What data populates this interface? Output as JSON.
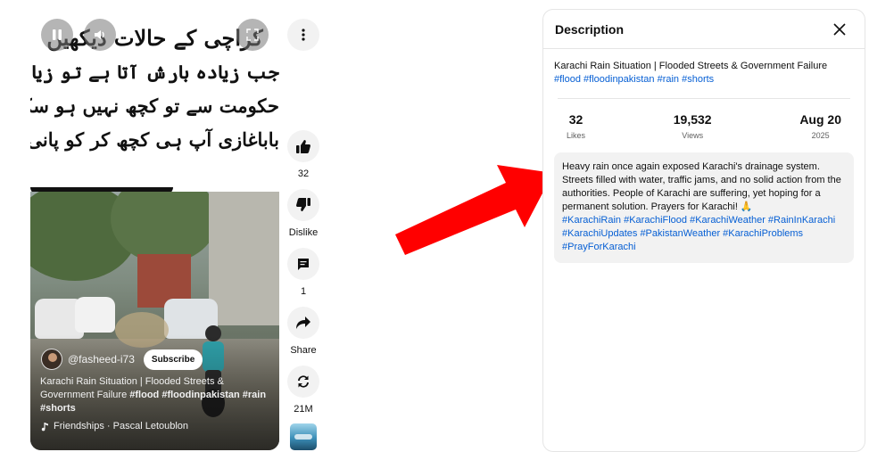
{
  "short": {
    "overlay_lines": [
      "کراچی کے حالات دیکھیں",
      "جب زیادہ بارش آتا ہے تو زیادہ پانی آتا ہے",
      "حکومت سے تو کچھ نہیں ہو سکا کراچی کے لیے",
      "باباغازی آپ ہی کچھ کر کو پانی کو روکو"
    ],
    "channel_name": "@fasheed-i73",
    "subscribe_label": "Subscribe",
    "caption_text": "Karachi Rain Situation | Flooded Streets & Government Failure",
    "caption_tags": "#flood #floodinpakistan #rain #shorts",
    "music": "Friendships · Pascal Letoublon",
    "icons": {
      "pause": "pause-icon",
      "volume": "volume-icon",
      "fullscreen": "fullscreen-icon",
      "music": "music-note-icon"
    }
  },
  "rail": {
    "like_count": "32",
    "dislike_label": "Dislike",
    "comment_count": "1",
    "share_label": "Share",
    "remix_count": "21M"
  },
  "panel": {
    "title": "Description",
    "video_title": "Karachi Rain Situation | Flooded Streets & Government Failure",
    "title_tags": "#flood #floodinpakistan #rain #shorts",
    "stats": [
      {
        "value": "32",
        "label": "Likes"
      },
      {
        "value": "19,532",
        "label": "Views"
      },
      {
        "value": "Aug 20",
        "label": "2025"
      }
    ],
    "description_text": "Heavy rain once again exposed Karachi's drainage system. Streets filled with water, traffic jams, and no solid action from the authorities. People of Karachi are suffering, yet hoping for a permanent solution. Prayers for Karachi! 🙏",
    "description_tags": "#KarachiRain #KarachiFlood #KarachiWeather #RainInKarachi #KarachiUpdates #PakistanWeather #KarachiProblems #PrayForKarachi"
  },
  "colors": {
    "arrow": "#ff0000",
    "hashtag": "#065fd4",
    "accent": "#0f0f0f"
  }
}
